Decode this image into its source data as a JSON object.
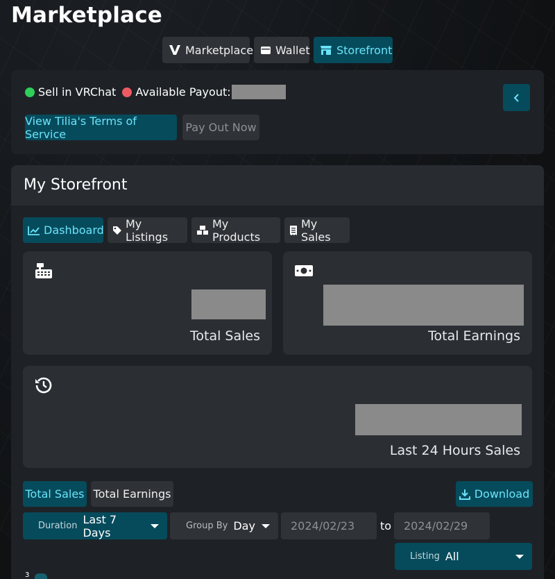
{
  "page": {
    "title": "Marketplace"
  },
  "topnav": [
    {
      "label": "Marketplace",
      "icon": "vrchat-v-icon"
    },
    {
      "label": "Wallet",
      "icon": "wallet-icon"
    },
    {
      "label": "Storefront",
      "icon": "storefront-icon",
      "active": true
    }
  ],
  "status": {
    "sell_label": "Sell in VRChat",
    "payout_label": "Available Payout:",
    "terms_button": "View Tilia's Terms of Service",
    "payout_button": "Pay Out Now"
  },
  "storefront": {
    "title": "My Storefront",
    "tabs": [
      {
        "label": "Dashboard",
        "icon": "chart-line-icon",
        "active": true
      },
      {
        "label": "My Listings",
        "icon": "tag-icon"
      },
      {
        "label": "My Products",
        "icon": "boxes-icon"
      },
      {
        "label": "My Sales",
        "icon": "receipt-icon"
      }
    ],
    "stats": {
      "total_sales": "Total Sales",
      "total_earnings": "Total Earnings",
      "last_24h": "Last 24 Hours Sales"
    },
    "chart_toggle": [
      {
        "label": "Total Sales",
        "active": true
      },
      {
        "label": "Total Earnings"
      }
    ],
    "download_label": "Download",
    "filters": {
      "duration_label": "Duration",
      "duration_value": "Last 7 Days",
      "group_label": "Group By",
      "group_value": "Day",
      "date_from": "2024/02/23",
      "date_to_word": "to",
      "date_to": "2024/02/29",
      "listing_label": "Listing",
      "listing_value": "All"
    },
    "chart_axis_tick": "3"
  },
  "colors": {
    "accent": "#064b5c",
    "accent_text": "#6ae3f9",
    "green": "#2fcf5a",
    "red": "#ee5a63"
  }
}
